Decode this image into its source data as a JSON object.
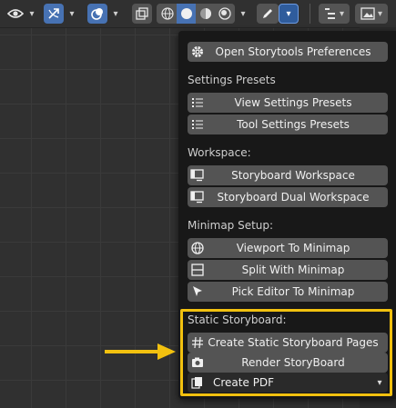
{
  "header": {
    "icons": [
      "eye-icon",
      "chevron-down-icon",
      "overlay-icon",
      "chevron-down-icon",
      "gizmo-icon",
      "chevron-down-icon",
      "xray-icon",
      "shading-wireframe-icon",
      "shading-solid-icon",
      "shading-material-icon",
      "shading-rendered-icon",
      "chevron-down-icon",
      "pencil-icon",
      "chevron-down-icon",
      "outliner-icon",
      "image-icon"
    ]
  },
  "menu": {
    "preferences_label": "Open Storytools Preferences",
    "settings_presets_title": "Settings Presets",
    "view_settings_label": "View Settings Presets",
    "tool_settings_label": "Tool Settings Presets",
    "workspace_title": "Workspace:",
    "storyboard_workspace_label": "Storyboard Workspace",
    "storyboard_dual_label": "Storyboard Dual Workspace",
    "minimap_title": "Minimap Setup:",
    "viewport_minimap_label": "Viewport To Minimap",
    "split_minimap_label": "Split With Minimap",
    "pick_editor_label": "Pick Editor To Minimap",
    "static_title": "Static Storyboard:",
    "create_pages_label": "Create Static Storyboard Pages",
    "render_label": "Render StoryBoard",
    "create_pdf_label": "Create PDF"
  },
  "colors": {
    "highlight": "#f2c10f",
    "accent_blue": "#4772b3",
    "button_bg": "#545454",
    "menu_bg": "#181818"
  }
}
